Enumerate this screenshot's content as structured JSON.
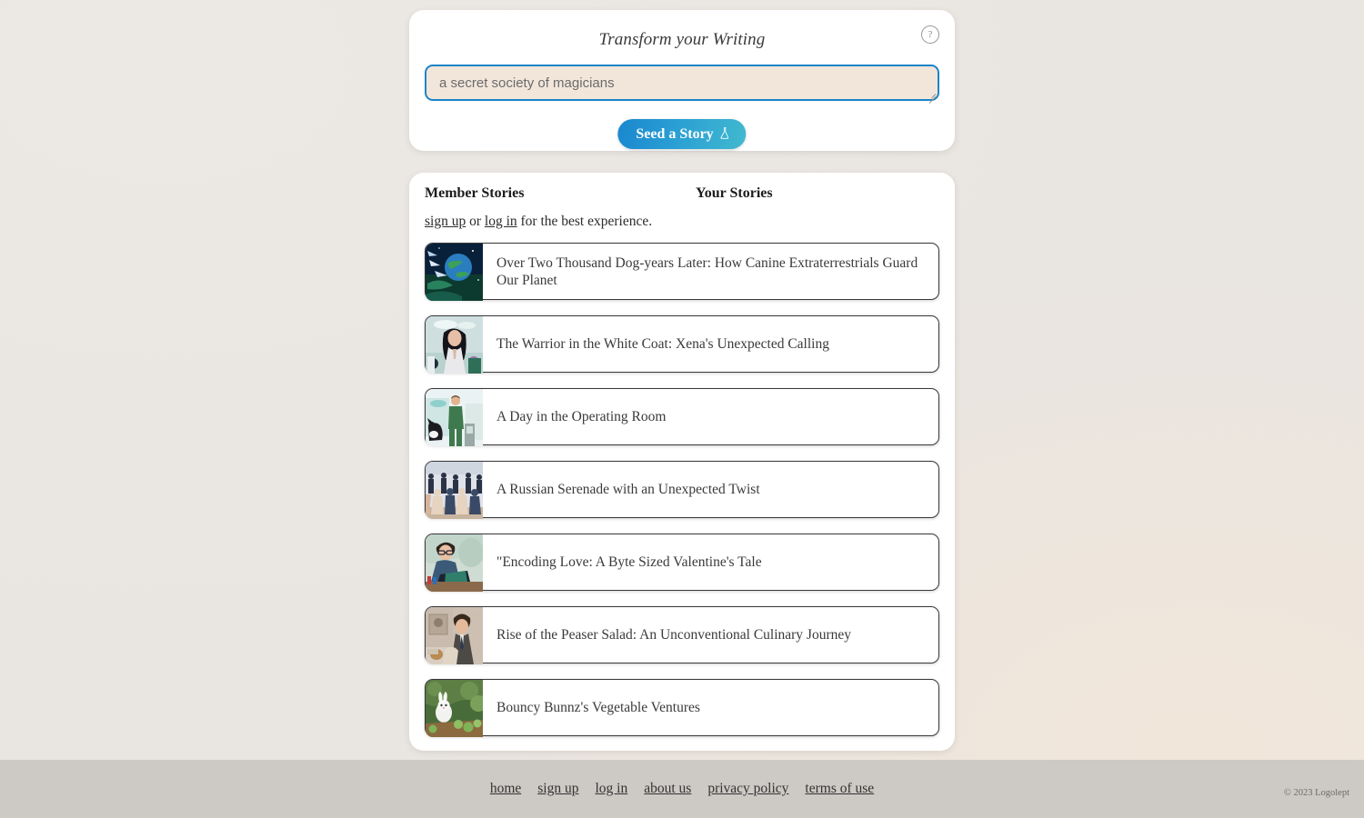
{
  "colors": {
    "page_background": "#e9e5e1",
    "panel_background": "#ffffff",
    "accent_blue": "#1b84c8",
    "accent_teal": "#41b9cf",
    "prompt_background": "#f2e6db",
    "footer_background": "#cdc9c5",
    "card_border": "#38383c",
    "text": "#3a3a3a"
  },
  "generator": {
    "title": "Transform your Writing",
    "help_icon": "question-mark-circle-icon",
    "prompt_value": "a secret society of magicians",
    "prompt_placeholder": "a secret society of magicians",
    "seed_button_label": "Seed a Story",
    "seed_button_icon": "flask-icon",
    "resize_handle": "textarea-resize-grip"
  },
  "stories": {
    "tabs": [
      {
        "label": "Member Stories",
        "active": true
      },
      {
        "label": "Your Stories",
        "active": false
      }
    ],
    "signin_prompt": {
      "sign_up": "sign up",
      "separator": " or ",
      "log_in": "log in",
      "tail": " for the best experience."
    },
    "items": [
      {
        "title": "Over Two Thousand Dog-years Later: How Canine Extraterrestrials Guard Our Planet",
        "thumb": "planet-space-thumbnail"
      },
      {
        "title": "The Warrior in the White Coat: Xena's Unexpected Calling",
        "thumb": "woman-doctor-thumbnail"
      },
      {
        "title": "A Day in the Operating Room",
        "thumb": "surgeon-dog-thumbnail"
      },
      {
        "title": "A Russian Serenade with an Unexpected Twist",
        "thumb": "ballroom-crowd-thumbnail"
      },
      {
        "title": "\"Encoding Love: A Byte Sized Valentine's Tale",
        "thumb": "man-laptop-thumbnail"
      },
      {
        "title": "Rise of the Peaser Salad: An Unconventional Culinary Journey",
        "thumb": "vintage-man-thumbnail"
      },
      {
        "title": "Bouncy Bunnz's Vegetable Ventures",
        "thumb": "rabbit-garden-thumbnail"
      }
    ]
  },
  "footer": {
    "links": [
      {
        "label": "home"
      },
      {
        "label": "sign up"
      },
      {
        "label": "log in"
      },
      {
        "label": "about us"
      },
      {
        "label": "privacy policy"
      },
      {
        "label": "terms of use"
      }
    ],
    "copyright": "© 2023 Logolept"
  }
}
